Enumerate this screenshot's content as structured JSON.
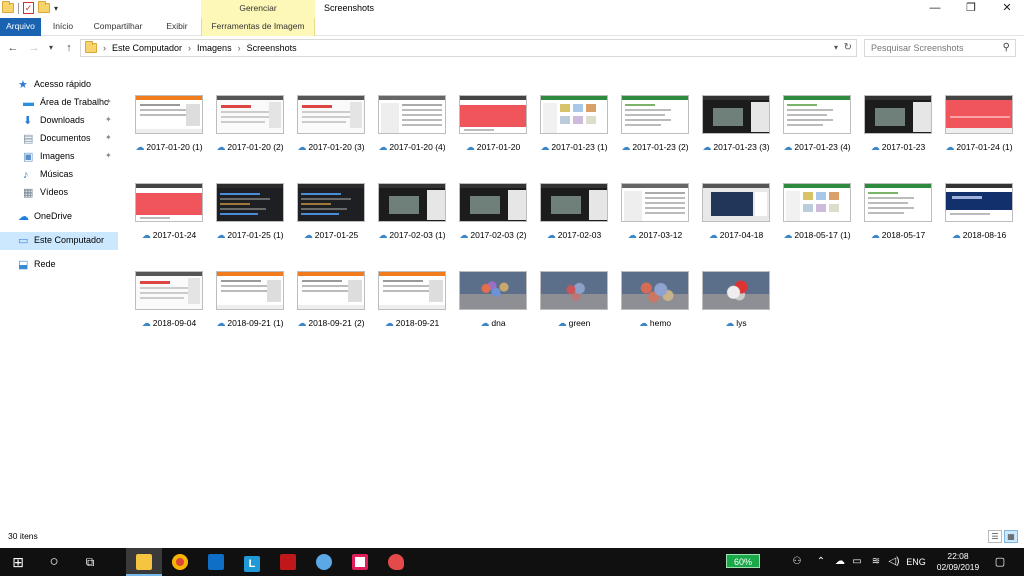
{
  "window": {
    "title": "Screenshots",
    "context_tab_group": "Gerenciar",
    "controls": {
      "minimize": "—",
      "maximize": "❐",
      "close": "✕"
    }
  },
  "ribbon": {
    "tabs": [
      {
        "label": "Arquivo"
      },
      {
        "label": "Início"
      },
      {
        "label": "Compartilhar"
      },
      {
        "label": "Exibir"
      },
      {
        "label": "Ferramentas de Imagem"
      }
    ]
  },
  "address": {
    "crumbs": [
      "Este Computador",
      "Imagens",
      "Screenshots"
    ],
    "separator": "›",
    "search_placeholder": "Pesquisar Screenshots"
  },
  "sidebar": {
    "items": [
      {
        "label": "Acesso rápido",
        "icon": "star-icon",
        "pinned": false,
        "selected": false
      },
      {
        "label": "Área de Trabalhc",
        "icon": "desktop-icon",
        "pinned": true,
        "selected": false
      },
      {
        "label": "Downloads",
        "icon": "download-icon",
        "pinned": true,
        "selected": false
      },
      {
        "label": "Documentos",
        "icon": "document-icon",
        "pinned": true,
        "selected": false
      },
      {
        "label": "Imagens",
        "icon": "pictures-icon",
        "pinned": true,
        "selected": false
      },
      {
        "label": "Músicas",
        "icon": "music-icon",
        "pinned": false,
        "selected": false
      },
      {
        "label": "Vídeos",
        "icon": "video-icon",
        "pinned": false,
        "selected": false
      },
      {
        "label": "OneDrive",
        "icon": "cloud-icon",
        "pinned": false,
        "selected": false
      },
      {
        "label": "Este Computador",
        "icon": "computer-icon",
        "pinned": false,
        "selected": true
      },
      {
        "label": "Rede",
        "icon": "network-icon",
        "pinned": false,
        "selected": false
      }
    ]
  },
  "files": [
    {
      "name": "2017-01-20 (1)",
      "thumb": "orange-web"
    },
    {
      "name": "2017-01-20 (2)",
      "thumb": "gray-web"
    },
    {
      "name": "2017-01-20 (3)",
      "thumb": "gray-web"
    },
    {
      "name": "2017-01-20 (4)",
      "thumb": "gray-list"
    },
    {
      "name": "2017-01-20",
      "thumb": "red-web"
    },
    {
      "name": "2017-01-23 (1)",
      "thumb": "green-app"
    },
    {
      "name": "2017-01-23 (2)",
      "thumb": "green-list"
    },
    {
      "name": "2017-01-23 (3)",
      "thumb": "dark-3d"
    },
    {
      "name": "2017-01-23 (4)",
      "thumb": "green-list"
    },
    {
      "name": "2017-01-23",
      "thumb": "dark-3d"
    },
    {
      "name": "2017-01-24 (1)",
      "thumb": "red-wave"
    },
    {
      "name": "2017-01-24",
      "thumb": "red-web"
    },
    {
      "name": "2017-01-25 (1)",
      "thumb": "dark-ide"
    },
    {
      "name": "2017-01-25",
      "thumb": "dark-ide"
    },
    {
      "name": "2017-02-03 (1)",
      "thumb": "dark-3d"
    },
    {
      "name": "2017-02-03 (2)",
      "thumb": "dark-3d"
    },
    {
      "name": "2017-02-03",
      "thumb": "dark-3d"
    },
    {
      "name": "2017-03-12",
      "thumb": "gray-list"
    },
    {
      "name": "2017-04-18",
      "thumb": "blue-desk"
    },
    {
      "name": "2018-05-17 (1)",
      "thumb": "green-app"
    },
    {
      "name": "2018-05-17",
      "thumb": "green-list"
    },
    {
      "name": "2018-08-16",
      "thumb": "navy-web"
    },
    {
      "name": "2018-09-04",
      "thumb": "gray-web"
    },
    {
      "name": "2018-09-21 (1)",
      "thumb": "orange-web"
    },
    {
      "name": "2018-09-21 (2)",
      "thumb": "orange-web"
    },
    {
      "name": "2018-09-21",
      "thumb": "orange-web"
    },
    {
      "name": "dna",
      "thumb": "molecule-dna"
    },
    {
      "name": "green",
      "thumb": "molecule-green"
    },
    {
      "name": "hemo",
      "thumb": "molecule-hemo"
    },
    {
      "name": "lys",
      "thumb": "molecule-lys"
    }
  ],
  "status": {
    "item_count": "30 itens"
  },
  "taskbar": {
    "battery": "60%",
    "language": "ENG",
    "time": "22:08",
    "date": "02/09/2019"
  },
  "colors": {
    "accent": "#1a63b1",
    "context_band": "#fdf7b8",
    "selected": "#cce8ff",
    "battery": "#1ba84a"
  }
}
